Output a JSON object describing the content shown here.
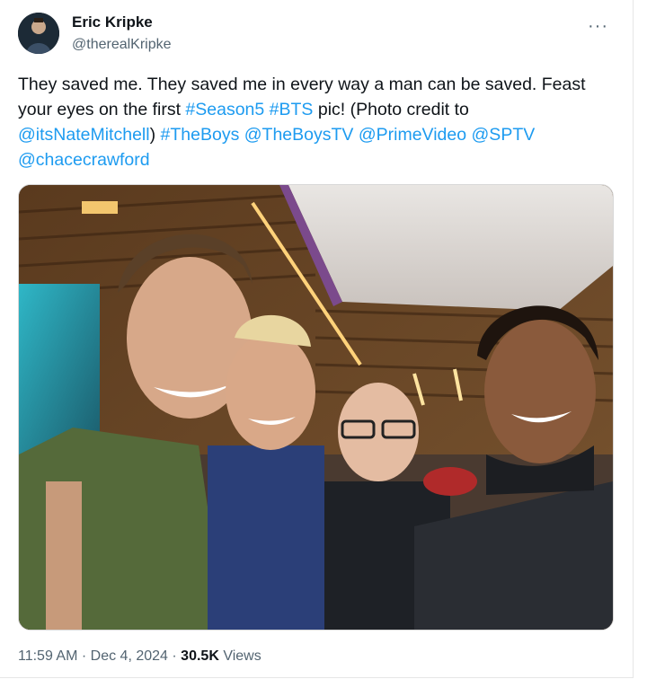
{
  "author": {
    "name": "Eric Kripke",
    "handle": "@therealKripke",
    "avatar_icon": "profile-avatar-icon"
  },
  "tweet": {
    "segments": [
      {
        "text": "They saved me. They saved me in every way a man can be saved. Feast your eyes on the first ",
        "link": false
      },
      {
        "text": "#Season5",
        "link": true
      },
      {
        "text": " ",
        "link": false
      },
      {
        "text": "#BTS",
        "link": true
      },
      {
        "text": " pic! (Photo credit to ",
        "link": false
      },
      {
        "text": "@itsNateMitchell",
        "link": true
      },
      {
        "text": ") ",
        "link": false
      },
      {
        "text": "#TheBoys",
        "link": true
      },
      {
        "text": " ",
        "link": false
      },
      {
        "text": "@TheBoysTV",
        "link": true
      },
      {
        "text": " ",
        "link": false
      },
      {
        "text": "@PrimeVideo",
        "link": true
      },
      {
        "text": " ",
        "link": false
      },
      {
        "text": "@SPTV",
        "link": true
      },
      {
        "text": " ",
        "link": false
      },
      {
        "text": "@chacecrawford",
        "link": true
      }
    ],
    "link_color": "#1d9bf0"
  },
  "meta": {
    "time": "11:59 AM",
    "separator": "·",
    "date": "Dec 4, 2024",
    "views_count": "30.5K",
    "views_label": "Views"
  },
  "more_icon": "more-options-icon"
}
